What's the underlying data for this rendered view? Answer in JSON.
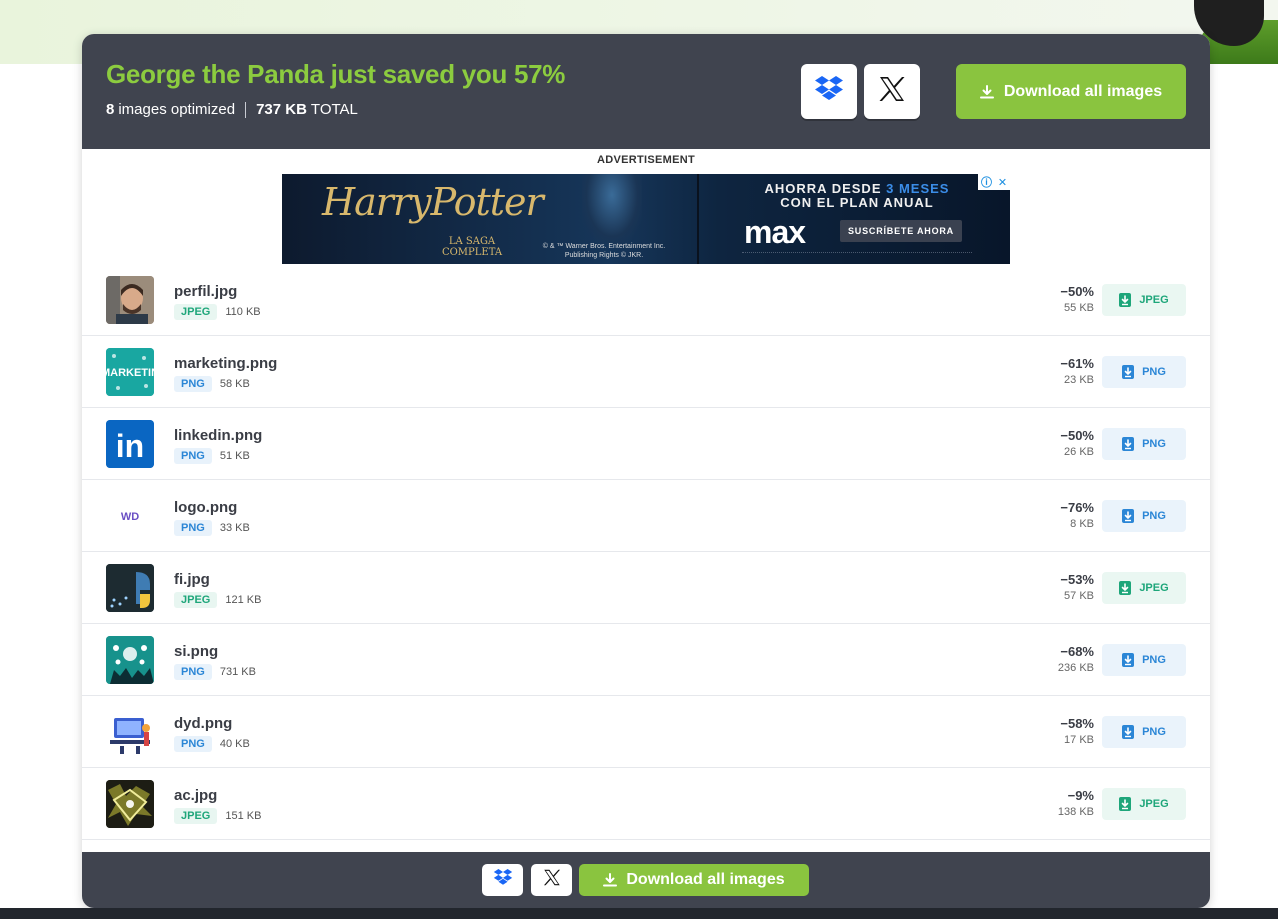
{
  "header": {
    "headline": "George the Panda just saved you 57%",
    "count": "8",
    "count_label": "images optimized",
    "total_size": "737 KB",
    "total_label": "TOTAL",
    "download_all_label": "Download all images"
  },
  "icons": {
    "dropbox": "dropbox-icon",
    "x": "x-logo-icon",
    "download": "download-icon",
    "file": "file-download-icon"
  },
  "ad": {
    "label": "ADVERTISEMENT",
    "title": "HarryPotter",
    "subtitle": "LA SAGA COMPLETA",
    "legal": "© & ™ Warner Bros. Entertainment Inc. Publishing Rights © JKR.",
    "offer_prefix": "AHORRA DESDE",
    "offer_highlight": "3 MESES",
    "offer_suffix": "CON EL PLAN ANUAL",
    "brand": "max",
    "cta": "SUSCRÍBETE AHORA"
  },
  "files": [
    {
      "name": "perfil.jpg",
      "type": "JPEG",
      "original": "110 KB",
      "saving": "−50%",
      "new_size": "55 KB"
    },
    {
      "name": "marketing.png",
      "type": "PNG",
      "original": "58 KB",
      "saving": "−61%",
      "new_size": "23 KB"
    },
    {
      "name": "linkedin.png",
      "type": "PNG",
      "original": "51 KB",
      "saving": "−50%",
      "new_size": "26 KB"
    },
    {
      "name": "logo.png",
      "type": "PNG",
      "original": "33 KB",
      "saving": "−76%",
      "new_size": "8 KB"
    },
    {
      "name": "fi.jpg",
      "type": "JPEG",
      "original": "121 KB",
      "saving": "−53%",
      "new_size": "57 KB"
    },
    {
      "name": "si.png",
      "type": "PNG",
      "original": "731 KB",
      "saving": "−68%",
      "new_size": "236 KB"
    },
    {
      "name": "dyd.png",
      "type": "PNG",
      "original": "40 KB",
      "saving": "−58%",
      "new_size": "17 KB"
    },
    {
      "name": "ac.jpg",
      "type": "JPEG",
      "original": "151 KB",
      "saving": "−9%",
      "new_size": "138 KB"
    }
  ],
  "thumbs": {
    "marketing_text": "MARKETIN",
    "linkedin_text": "in",
    "logo_text": "WD"
  },
  "footer": {
    "download_all_label": "Download all images"
  },
  "colors": {
    "header_bg": "#40444f",
    "accent_green": "#8ac43f",
    "headline_green": "#8ccc3f",
    "jpeg": "#1ea67a",
    "png": "#2b86d6"
  }
}
